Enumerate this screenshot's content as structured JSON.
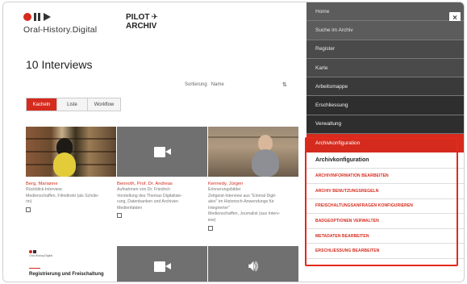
{
  "logo": {
    "text": "Oral-History.Digital"
  },
  "pilot": {
    "line1": "PILOT",
    "plane": "✈",
    "line2": "ARCHIV"
  },
  "count_label": "10 Interviews",
  "sort": {
    "label": "Sortierung",
    "value": "Name",
    "arrow": "⇅"
  },
  "tabs": [
    "Kacheln",
    "Liste",
    "Workflow"
  ],
  "cards": [
    {
      "title": "Berg, Marianne",
      "text": [
        "Rückblick-Interview",
        "Medienschaffen, Filmdirekt (als Schüle-",
        "rin)"
      ]
    },
    {
      "title": "Bennoth, Prof. Dr. Andreas",
      "text": [
        "Aufnahmen von Dr. Friedrich",
        "Vorstellung des Themas Digitalisie-",
        "rung, Datenbanken und Archivier-",
        "Medienfakten"
      ]
    },
    {
      "title": "Kennedy, Jürgen",
      "text": [
        "Erinnerungsbilder",
        "Zeitgeist-Interview aus \"Einmal Digit-",
        "ales\" im Historisch-Anwendungs für",
        "Integrierter\"",
        "Medienschaffen, Journalist (aus Interv-",
        "iew)"
      ]
    }
  ],
  "bottom_label": "Registrierung und Freischaltung",
  "mini_logo_text": "Oral-History.Digital",
  "menu": {
    "items": [
      "Home",
      "Suche im Archiv",
      "Register",
      "Karte",
      "Arbeitsmappe",
      "Erschliessung",
      "Verwaltung",
      "Archivkonfiguration"
    ],
    "close": "×",
    "submenu": {
      "title": "Archivkonfiguration",
      "items": [
        "ARCHIVINFORMATION BEARBEITEN",
        "ARCHIV BENUTZUNGSREGELN",
        "FREISCHALTUNGSANFRAGEN KONFIGURIEREN",
        "BADGEOPTIONEN VERWALTEN",
        "METADATEN BEARBEITEN",
        "ERSCHLIESSUNG BEARBEITEN"
      ]
    }
  },
  "colors": {
    "accent": "#d52b1e",
    "menu_dark": "#2e2e2e",
    "menu_mid": "#4a4a4a"
  }
}
